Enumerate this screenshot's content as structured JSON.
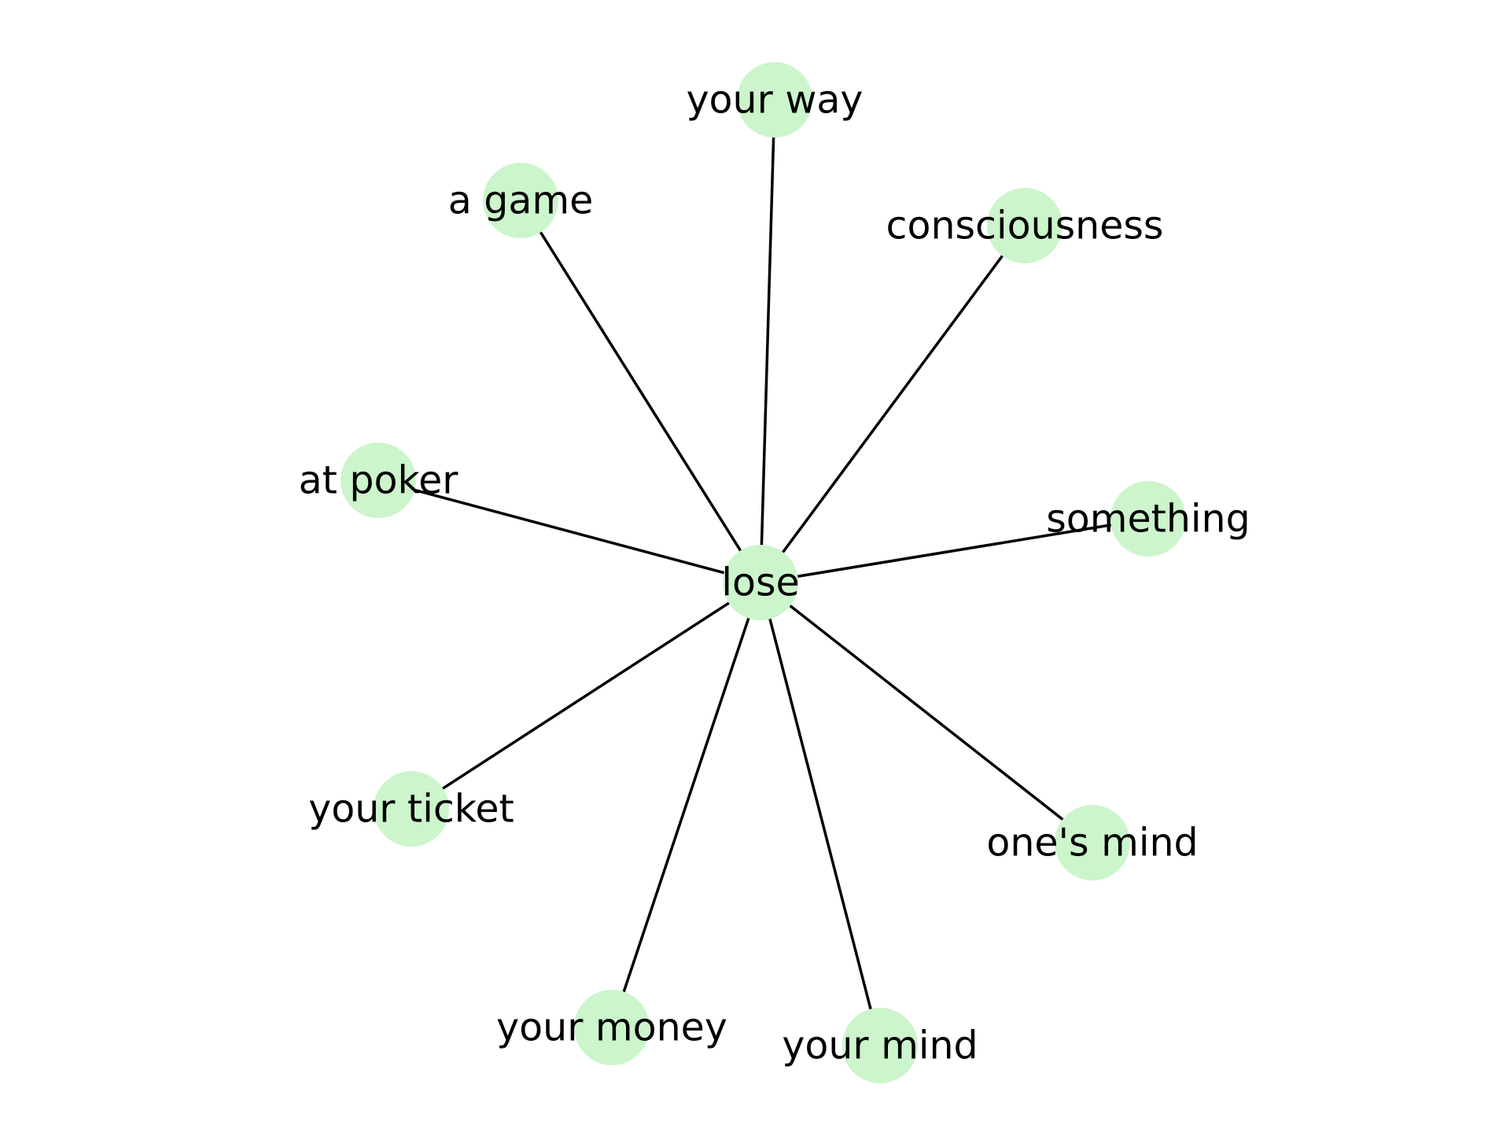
{
  "colors": {
    "background": "#ffffff",
    "node_fill": "#ccf5cc",
    "edge": "#000000",
    "label": "#000000"
  },
  "graph": {
    "center": {
      "id": "lose",
      "label": "lose"
    },
    "nodes": [
      {
        "id": "your-way",
        "label": "your way"
      },
      {
        "id": "a-game",
        "label": "a game"
      },
      {
        "id": "consciousness",
        "label": "consciousness"
      },
      {
        "id": "at-poker",
        "label": "at poker"
      },
      {
        "id": "something",
        "label": "something"
      },
      {
        "id": "your-ticket",
        "label": "your ticket"
      },
      {
        "id": "ones-mind",
        "label": "one's mind"
      },
      {
        "id": "your-money",
        "label": "your money"
      },
      {
        "id": "your-mind",
        "label": "your mind"
      }
    ],
    "edges": [
      [
        "lose",
        "your-way"
      ],
      [
        "lose",
        "a-game"
      ],
      [
        "lose",
        "consciousness"
      ],
      [
        "lose",
        "at-poker"
      ],
      [
        "lose",
        "something"
      ],
      [
        "lose",
        "your-ticket"
      ],
      [
        "lose",
        "ones-mind"
      ],
      [
        "lose",
        "your-money"
      ],
      [
        "lose",
        "your-mind"
      ]
    ]
  }
}
